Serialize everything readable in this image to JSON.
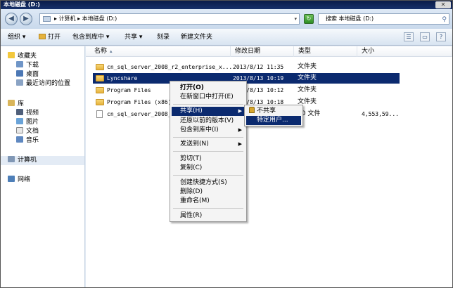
{
  "window": {
    "title": "本地磁盘 (D:)",
    "close": "✕"
  },
  "address": {
    "path": "▸ 计算机 ▸ 本地磁盘 (D:)",
    "search_placeholder": "搜索 本地磁盘 (D:)"
  },
  "toolbar": {
    "organize": "组织 ▾",
    "open": "打开",
    "include_in_library": "包含到库中 ▾",
    "share": "共享 ▾",
    "burn": "刻录",
    "new_folder": "新建文件夹"
  },
  "sidebar": {
    "favorites": "收藏夹",
    "downloads": "下载",
    "desktop": "桌面",
    "recent": "最近访问的位置",
    "library": "库",
    "videos": "视频",
    "pictures": "图片",
    "documents": "文档",
    "music": "音乐",
    "computer": "计算机",
    "network": "网络"
  },
  "columns": {
    "name": "名称",
    "date": "修改日期",
    "type": "类型",
    "size": "大小"
  },
  "files": [
    {
      "name": "cn_sql_server_2008_r2_enterprise_x...",
      "date": "2013/8/12 11:35",
      "type": "文件夹",
      "size": ""
    },
    {
      "name": "Lyncshare",
      "date": "2013/8/13 10:19",
      "type": "文件夹",
      "size": ""
    },
    {
      "name": "Program Files",
      "date": "2013/8/13 10:12",
      "type": "文件夹",
      "size": ""
    },
    {
      "name": "Program Files (x86)",
      "date": "2013/8/13 10:18",
      "type": "文件夹",
      "size": ""
    },
    {
      "name": "cn_sql_server_2008_r",
      "date": "",
      "type": "60 文件",
      "size": "4,553,59..."
    }
  ],
  "context_menu": {
    "open": "打开(O)",
    "open_new_window": "在新窗口中打开(E)",
    "share": "共享(H)",
    "restore": "还原以前的版本(V)",
    "include": "包含到库中(I)",
    "send_to": "发送到(N)",
    "cut": "剪切(T)",
    "copy": "复制(C)",
    "create_shortcut": "创建快捷方式(S)",
    "delete": "删除(D)",
    "rename": "重命名(M)",
    "properties": "属性(R)"
  },
  "share_submenu": {
    "nobody": "不共享",
    "specific": "特定用户..."
  },
  "colors": {
    "selection": "#0b2a6f",
    "titlebar": "#0a1c4a"
  }
}
